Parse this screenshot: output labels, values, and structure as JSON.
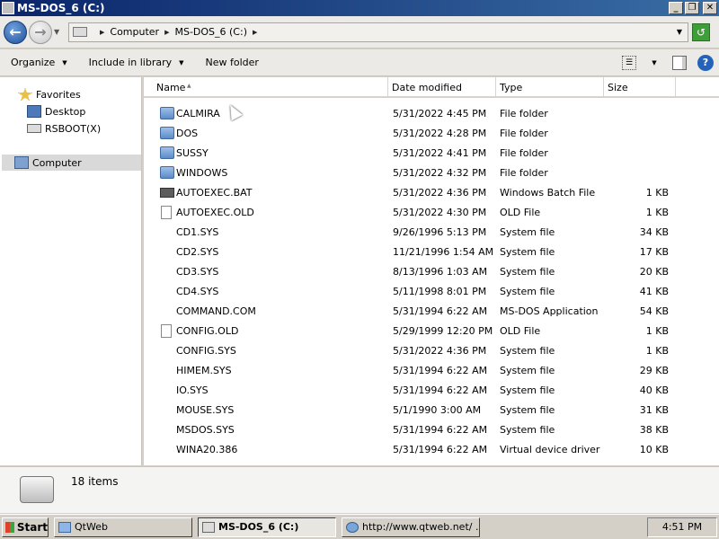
{
  "window": {
    "title": "MS-DOS_6 (C:)"
  },
  "address": {
    "crumbs": [
      "Computer",
      "MS-DOS_6 (C:)"
    ]
  },
  "toolbar": {
    "organize": "Organize",
    "include_in_library": "Include in library",
    "new_folder": "New folder",
    "help_glyph": "?"
  },
  "nav": {
    "favorites": "Favorites",
    "desktop": "Desktop",
    "rsboot": "RSBOOT(X)",
    "computer": "Computer"
  },
  "columns": {
    "name": "Name",
    "date": "Date modified",
    "type": "Type",
    "size": "Size"
  },
  "files": [
    {
      "name": "CALMIRA",
      "date": "5/31/2022 4:45 PM",
      "type": "File folder",
      "size": "",
      "icon": "folder-icon"
    },
    {
      "name": "DOS",
      "date": "5/31/2022 4:28 PM",
      "type": "File folder",
      "size": "",
      "icon": "folder-icon"
    },
    {
      "name": "SUSSY",
      "date": "5/31/2022 4:41 PM",
      "type": "File folder",
      "size": "",
      "icon": "folder-icon"
    },
    {
      "name": "WINDOWS",
      "date": "5/31/2022 4:32 PM",
      "type": "File folder",
      "size": "",
      "icon": "folder-icon"
    },
    {
      "name": "AUTOEXEC.BAT",
      "date": "5/31/2022 4:36 PM",
      "type": "Windows Batch File",
      "size": "1 KB",
      "icon": "batch-file-icon"
    },
    {
      "name": "AUTOEXEC.OLD",
      "date": "5/31/2022 4:30 PM",
      "type": "OLD File",
      "size": "1 KB",
      "icon": "document-icon"
    },
    {
      "name": "CD1.SYS",
      "date": "9/26/1996 5:13 PM",
      "type": "System file",
      "size": "34 KB",
      "icon": ""
    },
    {
      "name": "CD2.SYS",
      "date": "11/21/1996 1:54 AM",
      "type": "System file",
      "size": "17 KB",
      "icon": ""
    },
    {
      "name": "CD3.SYS",
      "date": "8/13/1996 1:03 AM",
      "type": "System file",
      "size": "20 KB",
      "icon": ""
    },
    {
      "name": "CD4.SYS",
      "date": "5/11/1998 8:01 PM",
      "type": "System file",
      "size": "41 KB",
      "icon": ""
    },
    {
      "name": "COMMAND.COM",
      "date": "5/31/1994 6:22 AM",
      "type": "MS-DOS Application",
      "size": "54 KB",
      "icon": ""
    },
    {
      "name": "CONFIG.OLD",
      "date": "5/29/1999 12:20 PM",
      "type": "OLD File",
      "size": "1 KB",
      "icon": "document-icon"
    },
    {
      "name": "CONFIG.SYS",
      "date": "5/31/2022 4:36 PM",
      "type": "System file",
      "size": "1 KB",
      "icon": ""
    },
    {
      "name": "HIMEM.SYS",
      "date": "5/31/1994 6:22 AM",
      "type": "System file",
      "size": "29 KB",
      "icon": ""
    },
    {
      "name": "IO.SYS",
      "date": "5/31/1994 6:22 AM",
      "type": "System file",
      "size": "40 KB",
      "icon": ""
    },
    {
      "name": "MOUSE.SYS",
      "date": "5/1/1990 3:00 AM",
      "type": "System file",
      "size": "31 KB",
      "icon": ""
    },
    {
      "name": "MSDOS.SYS",
      "date": "5/31/1994 6:22 AM",
      "type": "System file",
      "size": "38 KB",
      "icon": ""
    },
    {
      "name": "WINA20.386",
      "date": "5/31/1994 6:22 AM",
      "type": "Virtual device driver",
      "size": "10 KB",
      "icon": ""
    }
  ],
  "details": {
    "item_count": "18 items"
  },
  "taskbar": {
    "start": "Start",
    "tasks": [
      {
        "label": "QtWeb"
      },
      {
        "label": "MS-DOS_6 (C:)"
      },
      {
        "label": "http://www.qtweb.net/ ..."
      }
    ],
    "clock": "4:51 PM"
  },
  "colors": {
    "titlebar_start": "#0a246a",
    "titlebar_end": "#3a6ea5",
    "selection": "#d9d9d9"
  }
}
